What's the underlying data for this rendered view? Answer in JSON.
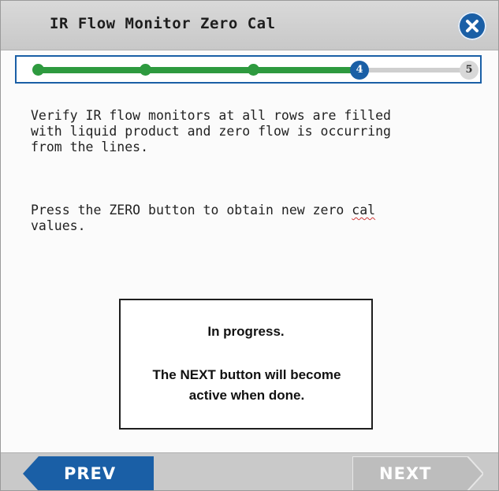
{
  "window": {
    "title": "IR Flow Monitor Zero Cal",
    "close_icon": "close-icon"
  },
  "stepper": {
    "total_steps": 5,
    "current_step": 4,
    "current_label": "4",
    "next_label": "5",
    "colors": {
      "done": "#2e9a3f",
      "current": "#1a5fa6",
      "pending": "#d8d8d8"
    }
  },
  "content": {
    "instruction_1": "Verify IR flow monitors at all rows are filled\nwith liquid product and zero flow is occurring\nfrom the lines.",
    "instruction_2_prefix": "Press the ZERO button to obtain new zero ",
    "instruction_2_word": "cal",
    "instruction_2_suffix": "\nvalues."
  },
  "status": {
    "line1": "In progress.",
    "line2": "The NEXT button will become active when done."
  },
  "nav": {
    "prev_label": "PREV",
    "next_label": "NEXT",
    "prev_color": "#1a5fa6",
    "next_color": "#bdbdbd"
  }
}
